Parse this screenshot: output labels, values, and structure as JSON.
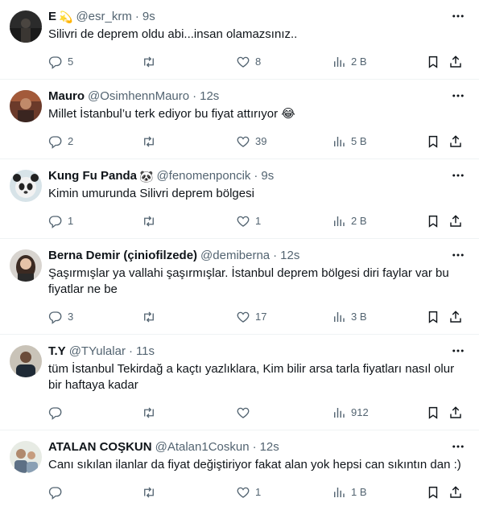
{
  "tweets": [
    {
      "name": "E",
      "emoji": "💫",
      "handle": "@esr_krm",
      "time": "9s",
      "text": "Silivri de deprem oldu abi...insan olamazsınız..",
      "replies": "5",
      "retweets": "",
      "likes": "8",
      "views": "2 B"
    },
    {
      "name": "Mauro",
      "emoji": "",
      "handle": "@OsimhennMauro",
      "time": "12s",
      "text": "Millet İstanbul’u terk ediyor bu fiyat attırıyor 😂",
      "replies": "2",
      "retweets": "",
      "likes": "39",
      "views": "5 B"
    },
    {
      "name": "Kung Fu Panda",
      "emoji": "🐼",
      "handle": "@fenomenponcik",
      "time": "9s",
      "text": "Kimin umurunda Silivri deprem bölgesi",
      "replies": "1",
      "retweets": "",
      "likes": "1",
      "views": "2 B"
    },
    {
      "name": "Berna Demir (çiniofilzede)",
      "emoji": "",
      "handle": "@demiberna",
      "time": "12s",
      "text": "Şaşırmışlar ya vallahi şaşırmışlar. İstanbul deprem bölgesi diri faylar var bu fiyatlar ne be",
      "replies": "3",
      "retweets": "",
      "likes": "17",
      "views": "3 B"
    },
    {
      "name": "T.Y",
      "emoji": "",
      "handle": "@TYulalar",
      "time": "11s",
      "text": "tüm İstanbul Tekirdağ a kaçtı yazlıklara, Kim bilir arsa tarla fiyatları nasıl olur bir haftaya kadar",
      "replies": "",
      "retweets": "",
      "likes": "",
      "views": "912"
    },
    {
      "name": "ATALAN COŞKUN",
      "emoji": "",
      "handle": "@Atalan1Coskun",
      "time": "12s",
      "text": "Canı sıkılan ilanlar da fiyat değiştiriyor fakat alan yok hepsi can sıkıntın dan :)",
      "replies": "",
      "retweets": "",
      "likes": "1",
      "views": "1 B"
    }
  ],
  "icons": {
    "more": "more-horizontal-icon",
    "reply": "reply-icon",
    "retweet": "retweet-icon",
    "like": "heart-icon",
    "views": "views-chart-icon",
    "bookmark": "bookmark-icon",
    "share": "share-icon"
  },
  "colors": {
    "text": "#0f1419",
    "secondary": "#536471",
    "divider": "#eff3f4"
  }
}
